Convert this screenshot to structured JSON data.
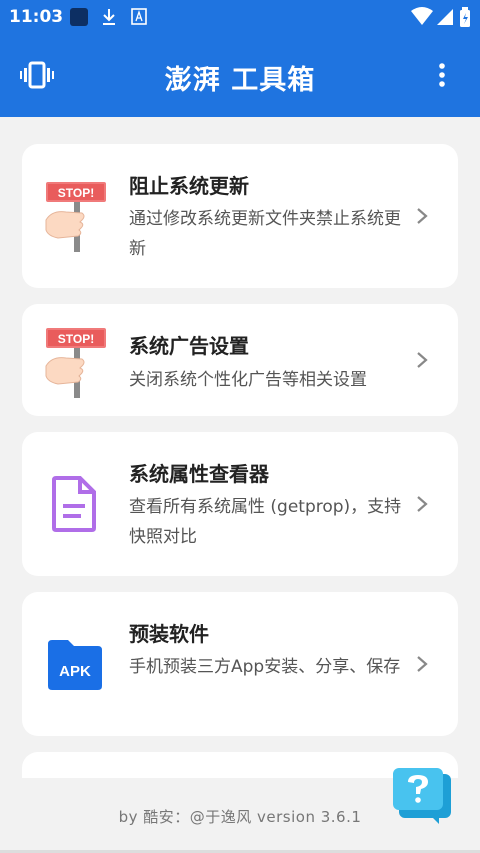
{
  "status": {
    "time": "11:03"
  },
  "appbar": {
    "title": "澎湃 工具箱"
  },
  "cards": [
    {
      "title": "阻止系统更新",
      "desc": "通过修改系统更新文件夹禁止系统更新"
    },
    {
      "title": "系统广告设置",
      "desc": "关闭系统个性化广告等相关设置"
    },
    {
      "title": "系统属性查看器",
      "desc": "查看所有系统属性 (getprop)，支持快照对比"
    },
    {
      "title": "预装软件",
      "desc": "手机预装三方App安装、分享、保存",
      "badge": "APK"
    }
  ],
  "sign": {
    "text": "STOP!"
  },
  "footer": {
    "text": "by 酷安：@于逸风 version 3.6.1"
  },
  "colors": {
    "primary": "#1f74e0",
    "background": "#f2f2f2",
    "card": "#ffffff"
  }
}
